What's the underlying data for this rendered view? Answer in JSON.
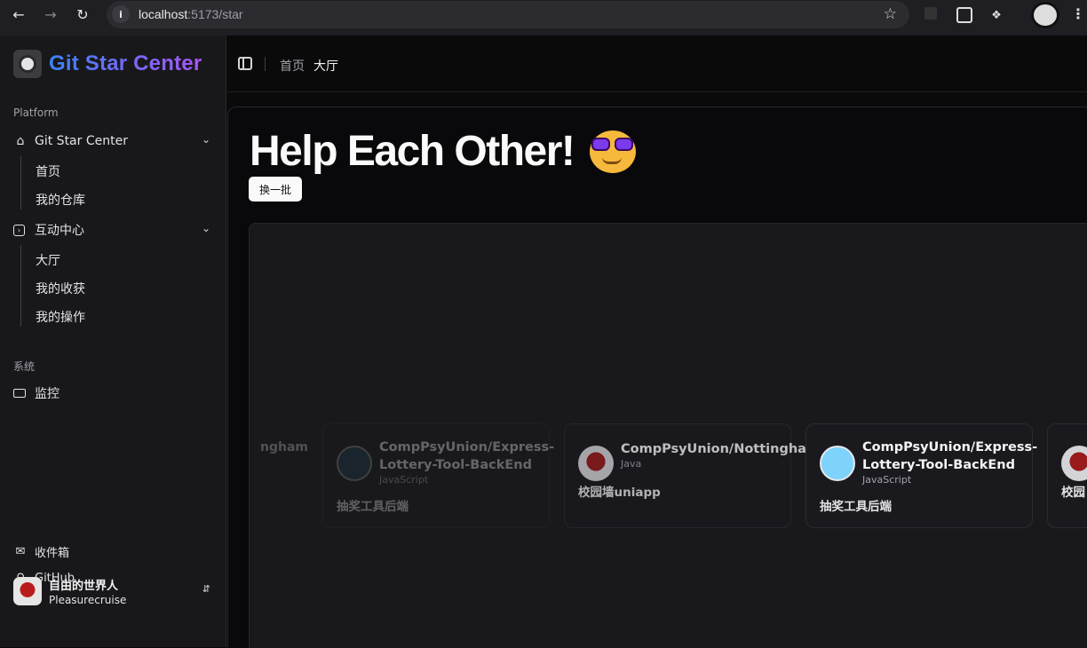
{
  "browser": {
    "url_host": "localhost",
    "url_path": ":5173/star"
  },
  "sidebar": {
    "brand": "Git Star Center",
    "platform_label": "Platform",
    "groups": [
      {
        "label": "Git Star Center",
        "items": [
          "首页",
          "我的仓库"
        ]
      },
      {
        "label": "互动中心",
        "items": [
          "大厅",
          "我的收获",
          "我的操作"
        ]
      }
    ],
    "system_label": "系统",
    "monitor": "监控",
    "inbox": "收件箱",
    "github": "GitHub",
    "user": {
      "name": "自由的世界人",
      "handle": "Pleasurecruise"
    }
  },
  "header": {
    "crumb_home": "首页",
    "crumb_current": "大厅"
  },
  "main": {
    "hero": "Help Each Other!",
    "refresh_label": "换一批",
    "ghost_text": "ngham",
    "cards": [
      {
        "title": "CompPsyUnion/Express-Lottery-Tool-BackEnd",
        "lang": "JavaScript",
        "desc": "抽奖工具后端"
      },
      {
        "title": "CompPsyUnion/Nottingham",
        "lang": "Java",
        "desc": "校园墙uniapp"
      },
      {
        "title": "CompPsyUnion/Express-Lottery-Tool-BackEnd",
        "lang": "JavaScript",
        "desc": "抽奖工具后端"
      },
      {
        "title": "",
        "lang": "",
        "desc": "校园"
      }
    ]
  },
  "colors": {
    "brand_gradient_start": "#3b82f6",
    "brand_gradient_end": "#a855f7",
    "background": "#0a0a0b",
    "sidebar": "#18181b"
  }
}
